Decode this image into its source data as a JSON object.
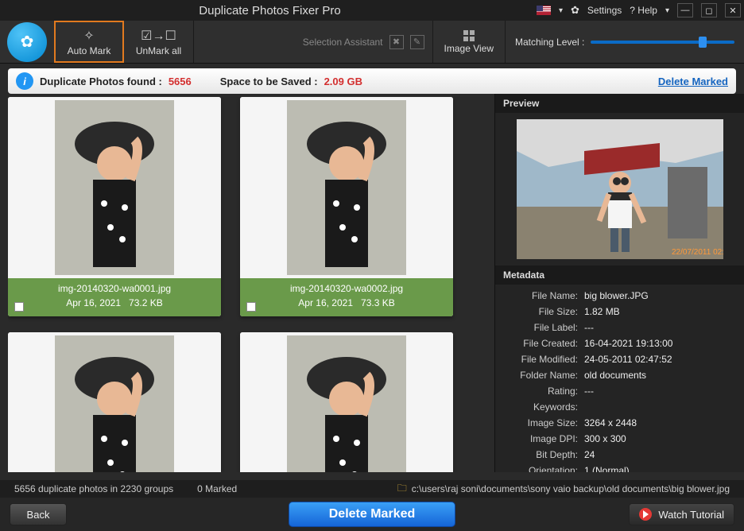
{
  "app": {
    "title": "Duplicate Photos Fixer Pro"
  },
  "titlebar": {
    "settings": "Settings",
    "help": "? Help"
  },
  "toolbar": {
    "auto_mark": "Auto Mark",
    "unmark_all": "UnMark all",
    "selection_assistant": "Selection Assistant",
    "image_view": "Image View",
    "matching_level": "Matching Level :"
  },
  "info": {
    "dup_label": "Duplicate Photos found :",
    "dup_count": "5656",
    "space_label": "Space to be Saved :",
    "space_val": "2.09 GB",
    "delete_marked": "Delete Marked"
  },
  "results": [
    {
      "file": "img-20140320-wa0001.jpg",
      "date": "Apr 16, 2021",
      "size": "73.2 KB",
      "show_meta": true
    },
    {
      "file": "img-20140320-wa0002.jpg",
      "date": "Apr 16, 2021",
      "size": "73.3 KB",
      "show_meta": true
    },
    {
      "file": "",
      "date": "",
      "size": "",
      "show_meta": false
    },
    {
      "file": "",
      "date": "",
      "size": "",
      "show_meta": false
    }
  ],
  "preview": {
    "label": "Preview"
  },
  "metadata": {
    "label": "Metadata",
    "rows": [
      {
        "k": "File Name:",
        "v": "big blower.JPG"
      },
      {
        "k": "File Size:",
        "v": "1.82 MB"
      },
      {
        "k": "File Label:",
        "v": "---"
      },
      {
        "k": "File Created:",
        "v": "16-04-2021 19:13:00"
      },
      {
        "k": "File Modified:",
        "v": "24-05-2011 02:47:52"
      },
      {
        "k": "Folder Name:",
        "v": "old documents"
      },
      {
        "k": "Rating:",
        "v": "---"
      },
      {
        "k": "Keywords:",
        "v": ""
      },
      {
        "k": "Image Size:",
        "v": "3264 x 2448"
      },
      {
        "k": "Image DPI:",
        "v": "300 x 300"
      },
      {
        "k": "Bit Depth:",
        "v": "24"
      },
      {
        "k": "Orientation:",
        "v": "1 (Normal)"
      }
    ]
  },
  "status": {
    "dups": "5656 duplicate photos in 2230 groups",
    "marked": "0 Marked",
    "path": "c:\\users\\raj soni\\documents\\sony vaio backup\\old documents\\big blower.jpg"
  },
  "bottom": {
    "back": "Back",
    "delete_marked": "Delete Marked",
    "watch": "Watch Tutorial"
  }
}
